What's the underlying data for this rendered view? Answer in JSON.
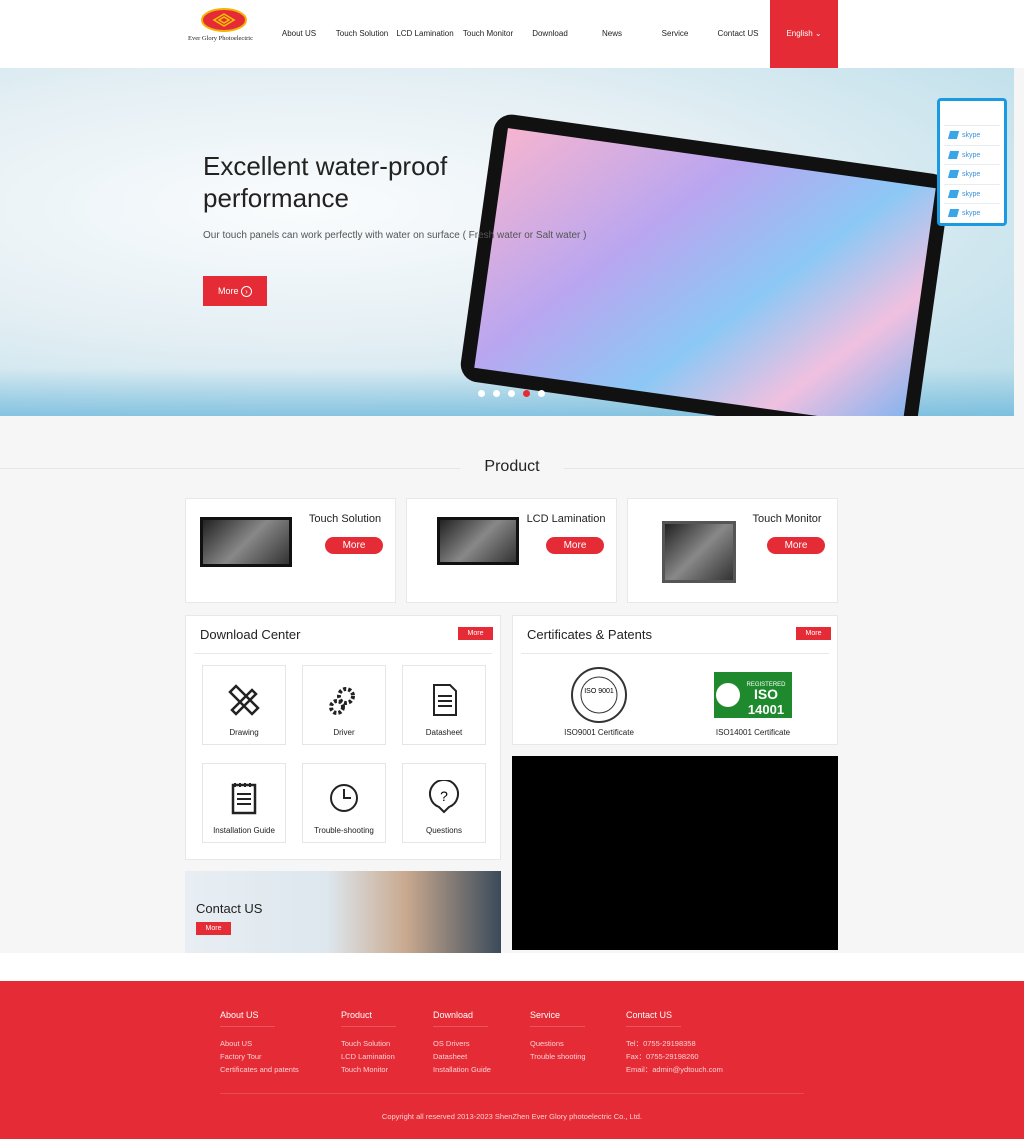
{
  "header": {
    "logo_text": "Ever Glory Photoelectric",
    "nav": [
      "About US",
      "Touch Solution",
      "LCD Lamination",
      "Touch Monitor",
      "Download",
      "News",
      "Service",
      "Contact US"
    ],
    "language": "English"
  },
  "hero": {
    "title": "Excellent water-proof performance",
    "subtitle": "Our touch panels can work perfectly with water on surface ( Fresh water or Salt water )",
    "more": "More",
    "slides": 5,
    "active_slide": 4
  },
  "skype": [
    "skype",
    "skype",
    "skype",
    "skype",
    "skype"
  ],
  "product": {
    "heading": "Product",
    "items": [
      {
        "title": "Touch Solution",
        "more": "More"
      },
      {
        "title": "LCD Lamination",
        "more": "More"
      },
      {
        "title": "Touch Monitor",
        "more": "More"
      }
    ]
  },
  "download": {
    "title": "Download Center",
    "more": "More",
    "items": [
      {
        "label": "Drawing",
        "icon": "drawing-tools-icon"
      },
      {
        "label": "Driver",
        "icon": "gears-icon"
      },
      {
        "label": "Datasheet",
        "icon": "document-icon"
      },
      {
        "label": "Installation Guide",
        "icon": "notepad-icon"
      },
      {
        "label": "Trouble-shooting",
        "icon": "clock-icon"
      },
      {
        "label": "Questions",
        "icon": "question-icon"
      }
    ]
  },
  "certs": {
    "title": "Certificates & Patents",
    "more": "More",
    "items": [
      "ISO9001 Certificate",
      "ISO14001 Certificate"
    ],
    "iso9001_seal": "ISO 9001",
    "iso14001_logo": "REGISTERED ISO 14001"
  },
  "contact_banner": {
    "title": "Contact US",
    "more": "More"
  },
  "footer": {
    "cols": [
      {
        "title": "About US",
        "links": [
          "About US",
          "Factory Tour",
          "Certificates and patents"
        ]
      },
      {
        "title": "Product",
        "links": [
          "Touch Solution",
          "LCD Lamination",
          "Touch Monitor"
        ]
      },
      {
        "title": "Download",
        "links": [
          "OS Drivers",
          "Datasheet",
          "Installation Guide"
        ]
      },
      {
        "title": "Service",
        "links": [
          "Questions",
          "Trouble shooting"
        ]
      },
      {
        "title": "Contact US",
        "links": [
          "Tel：0755-29198358",
          "Fax：0755-29198260",
          "Email：admin@ydtouch.com"
        ]
      }
    ],
    "copyright": "Copyright all reserved 2013-2023  ShenZhen Ever Glory photoelectric Co., Ltd."
  },
  "colors": {
    "brand": "#e52b35",
    "skype": "#1a9ae0"
  }
}
